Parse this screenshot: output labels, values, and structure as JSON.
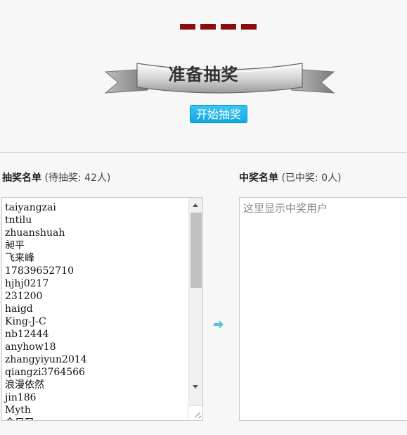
{
  "header": {
    "banner_text": "准备抽奖",
    "start_button": "开始抽奖"
  },
  "left_panel": {
    "title": "抽奖名单",
    "count_text": " (待抽奖: 42人)",
    "names": [
      "taiyangzai",
      "tntilu",
      "zhuanshuah",
      "昶平",
      "飞来峰",
      "17839652710",
      "hjhj0217",
      "231200",
      "haigd",
      "King-J-C",
      "nb12444",
      "anyhow18",
      "zhangyiyun2014",
      "qiangzi3764566",
      "浪漫依然",
      "jin186",
      "Myth",
      "今日又"
    ]
  },
  "right_panel": {
    "title": "中奖名单",
    "count_text": " (已中奖: 0人)",
    "placeholder": "这里显示中奖用户"
  },
  "colors": {
    "dash": "#8b0d0d",
    "button": "#1ab3e8",
    "arrow": "#5bc3de"
  }
}
